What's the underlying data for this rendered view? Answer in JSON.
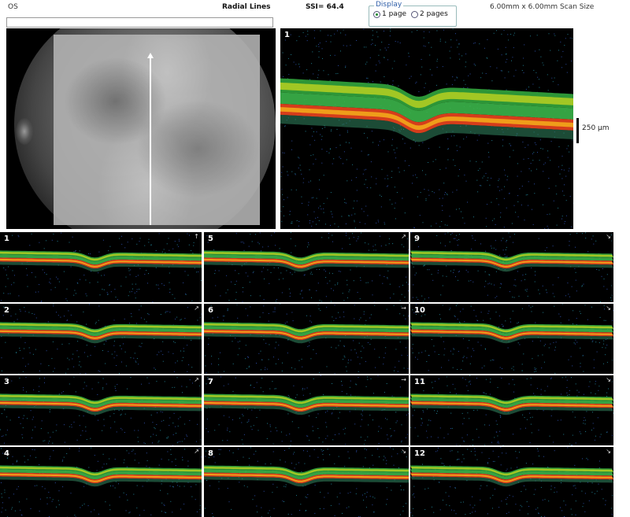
{
  "header": {
    "eye": "OS",
    "title": "Radial Lines",
    "ssi": "SSI= 64.4",
    "scan_size": "6.00mm x 6.00mm Scan Size"
  },
  "display": {
    "legend": "Display",
    "options": [
      "1 page",
      "2 pages"
    ],
    "selected": "1 page"
  },
  "main_scan": {
    "number": "1"
  },
  "scale": {
    "label": "250 µm"
  },
  "scans": [
    {
      "number": "1",
      "direction": "↑"
    },
    {
      "number": "2",
      "direction": "↗"
    },
    {
      "number": "3",
      "direction": "↗"
    },
    {
      "number": "4",
      "direction": "↗"
    },
    {
      "number": "5",
      "direction": "↗"
    },
    {
      "number": "6",
      "direction": "→"
    },
    {
      "number": "7",
      "direction": "→"
    },
    {
      "number": "8",
      "direction": "↘"
    },
    {
      "number": "9",
      "direction": "↘"
    },
    {
      "number": "10",
      "direction": "↘"
    },
    {
      "number": "11",
      "direction": "↘"
    },
    {
      "number": "12",
      "direction": "↘"
    }
  ],
  "colors": {
    "background": "#000000",
    "rpe": "#e0401c",
    "nfl": "#3bb54a",
    "inner": "#c9d71f"
  }
}
